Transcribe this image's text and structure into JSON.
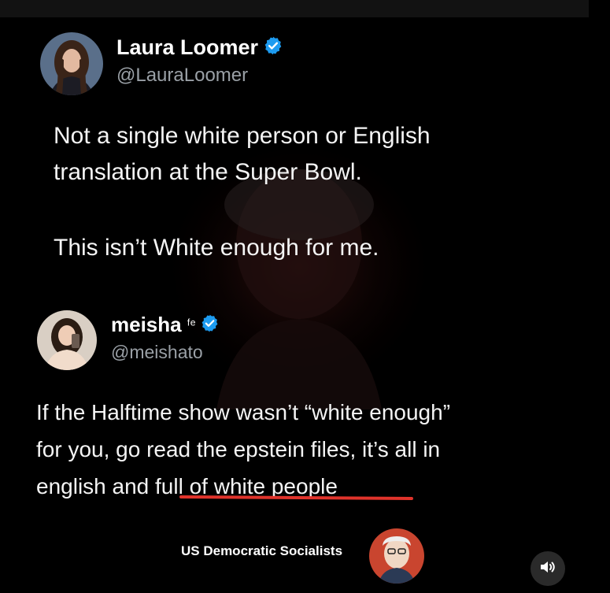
{
  "tweet1": {
    "name": "Laura Loomer",
    "handle": "@LauraLoomer",
    "text_line1": "Not a single white person or English",
    "text_line2": "translation at the Super Bowl.",
    "text_line3": "This isn’t White enough for me."
  },
  "tweet2": {
    "name": "meisha",
    "name_suffix": "ᶠᵉ",
    "handle": "@meishato",
    "text_line1": "If the Halftime show wasn’t “white enough”",
    "text_line2": "for you, go read the epstein files, it’s all in",
    "text_line3_a": "english and ",
    "text_line3_b": "full of white people"
  },
  "footer": {
    "label": "US Democratic Socialists"
  },
  "icons": {
    "verified": "verified-badge-icon",
    "sound": "speaker-icon"
  },
  "colors": {
    "verified": "#1d9bf0",
    "underline": "#e0332b",
    "background": "#000000"
  }
}
